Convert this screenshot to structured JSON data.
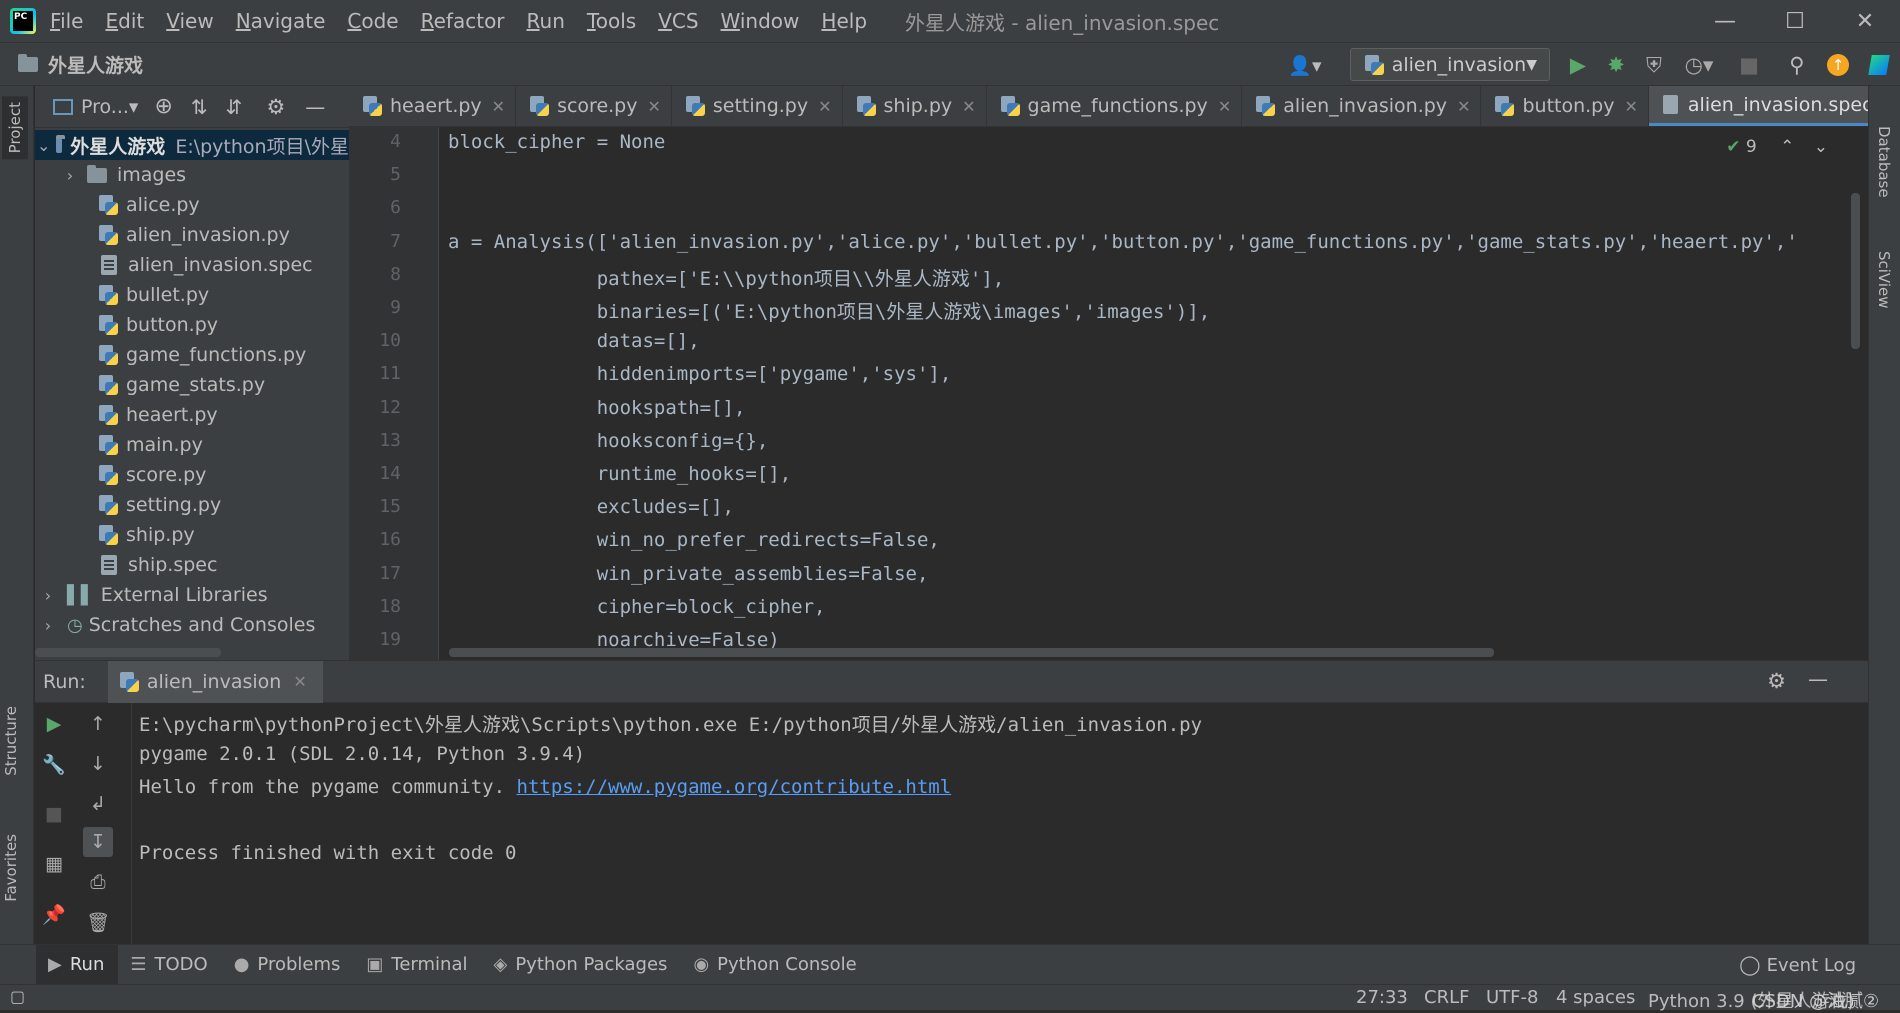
{
  "app": {
    "window_title": "外星人游戏 - alien_invasion.spec",
    "menu": [
      "File",
      "Edit",
      "View",
      "Navigate",
      "Code",
      "Refactor",
      "Run",
      "Tools",
      "VCS",
      "Window",
      "Help"
    ],
    "logo_text": "PC"
  },
  "navbar": {
    "breadcrumb": "外星人游戏",
    "run_config": "alien_invasion",
    "user_icon": "person-icon"
  },
  "project_panel": {
    "title": "Pro...▾",
    "root_label": "外星人游戏",
    "root_path": "E:\\python项目\\外星",
    "files": [
      {
        "name": "images",
        "type": "folder"
      },
      {
        "name": "alice.py",
        "type": "py"
      },
      {
        "name": "alien_invasion.py",
        "type": "py"
      },
      {
        "name": "alien_invasion.spec",
        "type": "spec"
      },
      {
        "name": "bullet.py",
        "type": "py"
      },
      {
        "name": "button.py",
        "type": "py"
      },
      {
        "name": "game_functions.py",
        "type": "py"
      },
      {
        "name": "game_stats.py",
        "type": "py"
      },
      {
        "name": "heaert.py",
        "type": "py"
      },
      {
        "name": "main.py",
        "type": "py"
      },
      {
        "name": "score.py",
        "type": "py"
      },
      {
        "name": "setting.py",
        "type": "py"
      },
      {
        "name": "ship.py",
        "type": "py"
      },
      {
        "name": "ship.spec",
        "type": "spec"
      }
    ],
    "external_libraries": "External Libraries",
    "scratches": "Scratches and Consoles"
  },
  "side_tabs": {
    "project": "Project",
    "structure": "Structure",
    "favorites": "Favorites",
    "database": "Database",
    "sciview": "SciView"
  },
  "tabs": [
    {
      "label": "heaert.py",
      "active": false
    },
    {
      "label": "score.py",
      "active": false
    },
    {
      "label": "setting.py",
      "active": false
    },
    {
      "label": "ship.py",
      "active": false
    },
    {
      "label": "game_functions.py",
      "active": false
    },
    {
      "label": "alien_invasion.py",
      "active": false
    },
    {
      "label": "button.py",
      "active": false
    },
    {
      "label": "alien_invasion.spec",
      "active": true
    }
  ],
  "editor": {
    "inspection_count": "9",
    "line_numbers": [
      "4",
      "5",
      "6",
      "7",
      "8",
      "9",
      "10",
      "11",
      "12",
      "13",
      "14",
      "15",
      "16",
      "17",
      "18",
      "19"
    ],
    "lines": [
      "block_cipher = None",
      "",
      "",
      "a = Analysis(['alien_invasion.py','alice.py','bullet.py','button.py','game_functions.py','game_stats.py','heaert.py','",
      "             pathex=['E:\\\\python项目\\\\外星人游戏'],",
      "             binaries=[('E:\\python项目\\外星人游戏\\images','images')],",
      "             datas=[],",
      "             hiddenimports=['pygame','sys'],",
      "             hookspath=[],",
      "             hooksconfig={},",
      "             runtime_hooks=[],",
      "             excludes=[],",
      "             win_no_prefer_redirects=False,",
      "             win_private_assemblies=False,",
      "             cipher=block_cipher,",
      "             noarchive=False)"
    ]
  },
  "run_panel": {
    "label": "Run:",
    "tab": "alien_invasion",
    "output": [
      "E:\\pycharm\\pythonProject\\外星人游戏\\Scripts\\python.exe E:/python项目/外星人游戏/alien_invasion.py",
      "pygame 2.0.1 (SDL 2.0.14, Python 3.9.4)",
      "Hello from the pygame community. ",
      "",
      "Process finished with exit code 0"
    ],
    "link": "https://www.pygame.org/contribute.html"
  },
  "tool_windows": [
    {
      "label": "Run",
      "icon": "▶",
      "active": true
    },
    {
      "label": "TODO",
      "icon": "☰",
      "active": false
    },
    {
      "label": "Problems",
      "icon": "●",
      "active": false
    },
    {
      "label": "Terminal",
      "icon": "▣",
      "active": false
    },
    {
      "label": "Python Packages",
      "icon": "◈",
      "active": false
    },
    {
      "label": "Python Console",
      "icon": "◉",
      "active": false
    }
  ],
  "event_log": "Event Log",
  "status": {
    "position": "27:33",
    "line_sep": "CRLF",
    "encoding": "UTF-8",
    "indent": "4 spaces",
    "interpreter": "Python 3.9 (外星人游戏)",
    "watermark": "CSDN @油腻②"
  },
  "colors": {
    "accent": "#4a88c7",
    "run_green": "#59a869",
    "update_orange": "#f5a623",
    "link": "#589df6"
  }
}
